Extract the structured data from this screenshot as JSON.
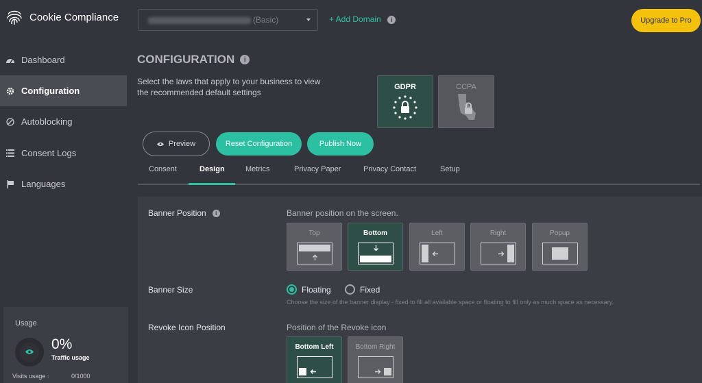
{
  "app": {
    "title": "Cookie Compliance"
  },
  "sidebar": {
    "items": [
      {
        "label": "Dashboard",
        "icon": "dashboard-icon"
      },
      {
        "label": "Configuration",
        "icon": "gear-icon",
        "active": true
      },
      {
        "label": "Autoblocking",
        "icon": "block-icon"
      },
      {
        "label": "Consent Logs",
        "icon": "list-icon"
      },
      {
        "label": "Languages",
        "icon": "flag-icon"
      }
    ],
    "usage": {
      "title": "Usage",
      "percent": "0%",
      "subtitle": "Traffic usage",
      "visits_label": "Visits usage :",
      "visits_value": "0/1000"
    }
  },
  "header": {
    "domain_plan": "(Basic)",
    "add_domain": "+ Add Domain",
    "upgrade": "Upgrade to Pro"
  },
  "config": {
    "title": "CONFIGURATION",
    "laws_description": "Select the laws that apply to your business to view the recommended default settings",
    "laws": [
      {
        "label": "GDPR",
        "selected": true
      },
      {
        "label": "CCPA",
        "selected": false
      }
    ],
    "buttons": {
      "preview": "Preview",
      "reset": "Reset Configuration",
      "publish": "Publish Now"
    },
    "tabs": [
      "Consent",
      "Design",
      "Metrics",
      "Privacy Paper",
      "Privacy Contact",
      "Setup"
    ],
    "active_tab": "Design"
  },
  "design": {
    "banner_position": {
      "label": "Banner Position",
      "hint": "Banner position on the screen.",
      "options": [
        "Top",
        "Bottom",
        "Left",
        "Right",
        "Popup"
      ],
      "selected": "Bottom"
    },
    "banner_size": {
      "label": "Banner Size",
      "options": [
        "Floating",
        "Fixed"
      ],
      "selected": "Floating",
      "description": "Choose the size of the banner display - fixed to fill all available space or floating to fill only as much space as necessary."
    },
    "revoke_icon": {
      "label": "Revoke Icon Position",
      "hint": "Position of the Revoke icon",
      "options": [
        "Bottom Left",
        "Bottom Right"
      ],
      "selected": "Bottom Left"
    }
  },
  "colors": {
    "accent": "#2bc0a2",
    "upgrade": "#f4c20d",
    "background": "#33353c",
    "selected_card": "#2d4f48"
  }
}
